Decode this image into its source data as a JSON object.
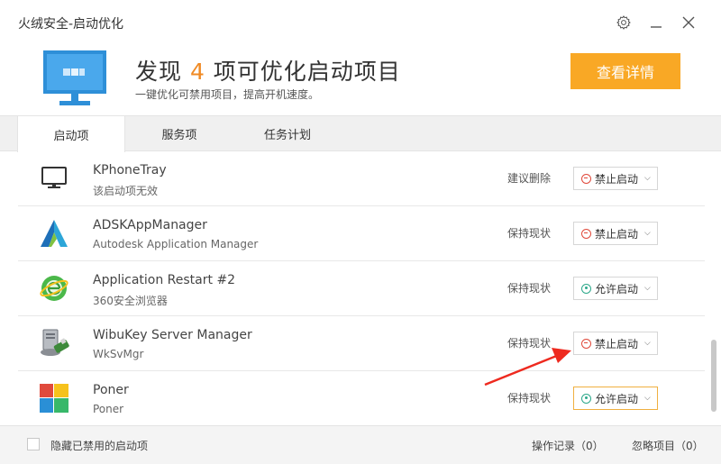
{
  "window": {
    "title": "火绒安全-启动优化",
    "controls": [
      "gear-icon",
      "minimize-icon",
      "close-icon"
    ]
  },
  "header": {
    "headline_prefix": "发现 ",
    "count": "4",
    "headline_suffix": " 项可优化启动项目",
    "subtitle": "一键优化可禁用项目，提高开机速度。",
    "detail_button": "查看详情",
    "accent_color": "#f08a24",
    "button_color": "#f9a825"
  },
  "tabs": [
    {
      "label": "启动项",
      "active": true
    },
    {
      "label": "服务项",
      "active": false
    },
    {
      "label": "任务计划",
      "active": false
    }
  ],
  "items": [
    {
      "icon": "monitor-icon",
      "name": "KPhoneTray",
      "desc": "该启动项无效",
      "advice": "建议删除",
      "action": "禁止启动",
      "action_icon": "ban"
    },
    {
      "icon": "autodesk-icon",
      "name": "ADSKAppManager",
      "desc": "Autodesk Application Manager",
      "advice": "保持现状",
      "action": "禁止启动",
      "action_icon": "ban"
    },
    {
      "icon": "browser-360-icon",
      "name": "Application Restart #2",
      "desc": "360安全浏览器",
      "advice": "保持现状",
      "action": "允许启动",
      "action_icon": "ok"
    },
    {
      "icon": "server-icon",
      "name": "WibuKey Server Manager",
      "desc": "WkSvMgr",
      "advice": "保持现状",
      "action": "禁止启动",
      "action_icon": "ban"
    },
    {
      "icon": "poner-icon",
      "name": "Poner",
      "desc": "Poner",
      "advice": "保持现状",
      "action": "允许启动",
      "action_icon": "ok"
    }
  ],
  "footer": {
    "hide_disabled_label": "隐藏已禁用的启动项",
    "operation_log": "操作记录（0）",
    "ignored_items": "忽略项目（0）"
  },
  "annotation": {
    "color": "#ee2a1f"
  }
}
